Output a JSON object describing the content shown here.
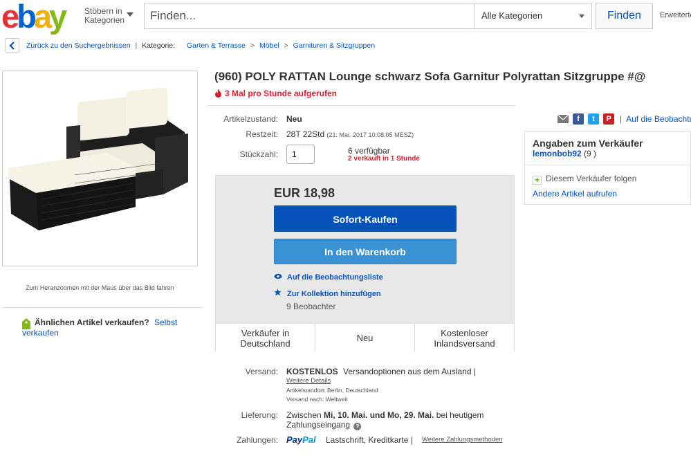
{
  "header": {
    "logo": {
      "e": "e",
      "b": "b",
      "a": "a",
      "y": "y"
    },
    "browse_label": "Stöbern in Kategorien",
    "search_placeholder": "Finden...",
    "category_select": "Alle Kategorien",
    "search_button": "Finden",
    "advanced_link": "Erweiterte"
  },
  "breadcrumb": {
    "back_label": "Zurück zu den Suchergebnissen",
    "category_label": "Kategorie:",
    "items": [
      "Garten & Terrasse",
      "Möbel",
      "Garnituren & Sitzgruppen"
    ]
  },
  "gallery": {
    "zoom_hint": "Zum Heranzoomen mit der Maus über das Bild fahren"
  },
  "sell_similar": {
    "question": "Ähnlichen Artikel verkaufen?",
    "link": "Selbst verkaufen"
  },
  "item": {
    "title": "(960) POLY RATTAN Lounge schwarz Sofa Garnitur Polyrattan Sitzgruppe #@",
    "views": "3 Mal pro Stunde aufgerufen",
    "condition_label": "Artikelzustand:",
    "condition": "Neu",
    "time_label": "Restzeit:",
    "time_left": "28T 22Std",
    "end_date": "(21. Mai. 2017   10:08:05 MESZ)",
    "qty_label": "Stückzahl:",
    "qty_value": "1",
    "available": "6 verfügbar",
    "sold": "2 verkauft in 1 Stunde"
  },
  "buybox": {
    "price": "EUR 18,98",
    "buy_now": "Sofort-Kaufen",
    "add_to_cart": "In den Warenkorb",
    "watch_link": "Auf die Beobachtungsliste",
    "collection_link": "Zur Kollektion hinzufügen",
    "watchers": "9 Beobachter",
    "features": [
      "Verkäufer in Deutschland",
      "Neu",
      "Kostenloser Inlandsversand"
    ]
  },
  "shipping": {
    "label": "Versand:",
    "free": "KOSTENLOS",
    "options": "Versandoptionen aus dem Ausland |",
    "more_link": "Weitere Details",
    "location": "Artikelstandort:  Berlin, Deutschland",
    "ships_to": "Versand nach:  Weltweit"
  },
  "delivery": {
    "label": "Lieferung:",
    "prefix": "Zwischen",
    "range": "Mi, 10. Mai. und Mo, 29. Mai.",
    "suffix": "bei heutigem Zahlungseingang",
    "help": "?"
  },
  "payment": {
    "label": "Zahlungen:",
    "paypal_1": "Pay",
    "paypal_2": "Pal",
    "other": "Lastschrift,   Kreditkarte   |",
    "more_link": "Weitere Zahlungsmethoden"
  },
  "share": {
    "watch_link": "Auf die Beobachtu",
    "pipe": "|",
    "facebook": "f",
    "twitter": "t",
    "pinterest": "P"
  },
  "seller": {
    "heading": "Angaben zum Verkäufer",
    "name": "lemonbob92",
    "feedback": "(9 )",
    "follow": "Diesem Verkäufer folgen",
    "follow_icon": "+",
    "other_items": "Andere Artikel aufrufen"
  },
  "colors": {
    "ebay_red": "#e53238",
    "ebay_blue": "#0064d2",
    "ebay_yellow": "#f5af02",
    "ebay_green": "#86b817",
    "link_blue": "#0654ba",
    "buy_button": "#0654ba",
    "cart_button": "#3a91d4",
    "alert_red": "#dd1e31"
  }
}
